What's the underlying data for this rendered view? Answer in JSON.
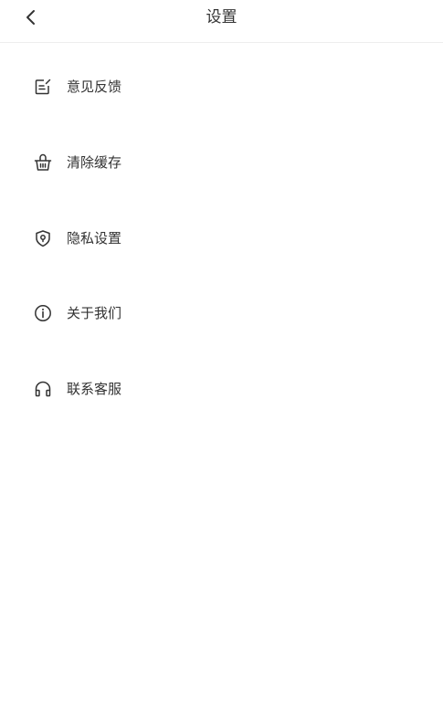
{
  "header": {
    "title": "设置",
    "back_icon": "chevron-left-icon"
  },
  "menu": {
    "items": [
      {
        "label": "意见反馈",
        "icon": "feedback-icon"
      },
      {
        "label": "清除缓存",
        "icon": "basket-icon"
      },
      {
        "label": "隐私设置",
        "icon": "shield-icon"
      },
      {
        "label": "关于我们",
        "icon": "info-icon"
      },
      {
        "label": "联系客服",
        "icon": "headphones-icon"
      }
    ]
  },
  "colors": {
    "background": "#ffffff",
    "text": "#333333",
    "divider": "#eeeeee"
  }
}
